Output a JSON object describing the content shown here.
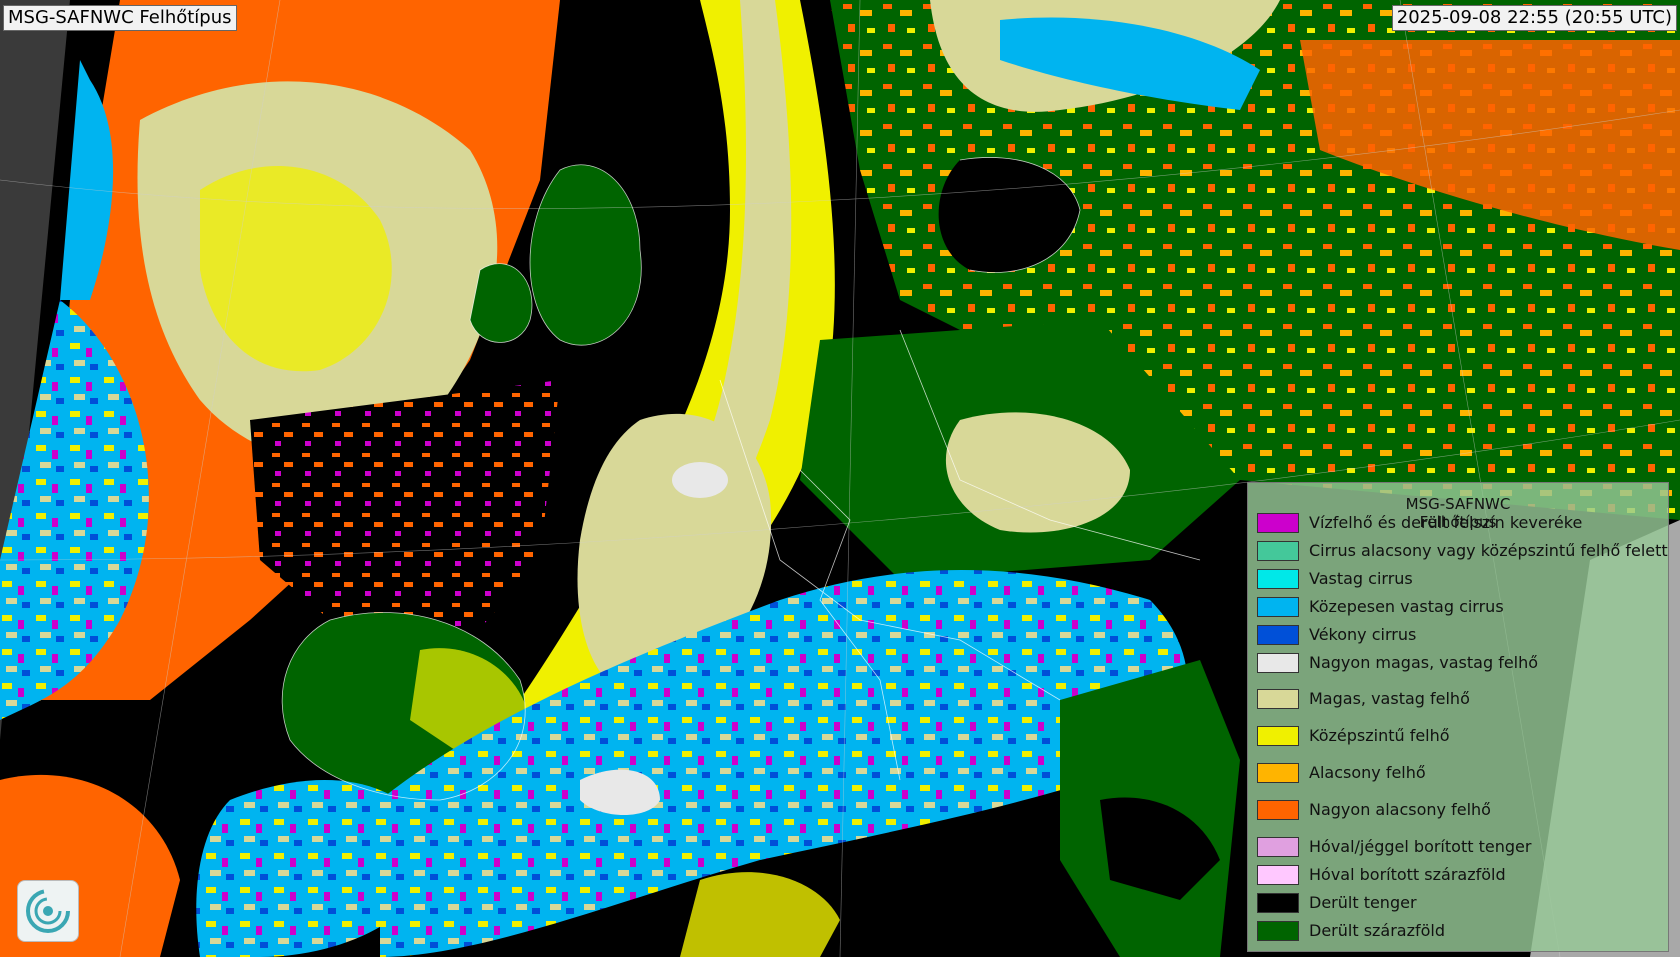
{
  "header": {
    "title": "MSG-SAFNWC Felhőtípus",
    "timestamp": "2025-09-08 22:55 (20:55 UTC)"
  },
  "legend": {
    "title": "MSG-SAFNWC",
    "subtitle": "Felhőtípus",
    "items": [
      {
        "label": "Vízfelhő és derült felszín keveréke",
        "color": "#cc00cc"
      },
      {
        "label": "Cirrus alacsony vagy középszintű felhő felett",
        "color": "#44c89a"
      },
      {
        "label": "Vastag cirrus",
        "color": "#00e8e8"
      },
      {
        "label": "Közepesen vastag cirrus",
        "color": "#00b4f0"
      },
      {
        "label": "Vékony cirrus",
        "color": "#0050d8"
      },
      {
        "label": "Nagyon magas, vastag felhő",
        "color": "#e8e8e8"
      },
      {
        "label": "Magas, vastag felhő",
        "color": "#d8d898"
      },
      {
        "label": "Középszintű felhő",
        "color": "#f0f000"
      },
      {
        "label": "Alacsony felhő",
        "color": "#ffb400"
      },
      {
        "label": "Nagyon alacsony felhő",
        "color": "#ff6400"
      },
      {
        "label": "Hóval/jéggel borított tenger",
        "color": "#e0a0e0"
      },
      {
        "label": "Hóval borított szárazföld",
        "color": "#ffc8ff"
      },
      {
        "label": "Derült tenger",
        "color": "#000000"
      },
      {
        "label": "Derült szárazföld",
        "color": "#006400"
      }
    ]
  },
  "map": {
    "icon": "satellite-cloud-type-map",
    "logo_icon": "swirl-logo-icon"
  }
}
